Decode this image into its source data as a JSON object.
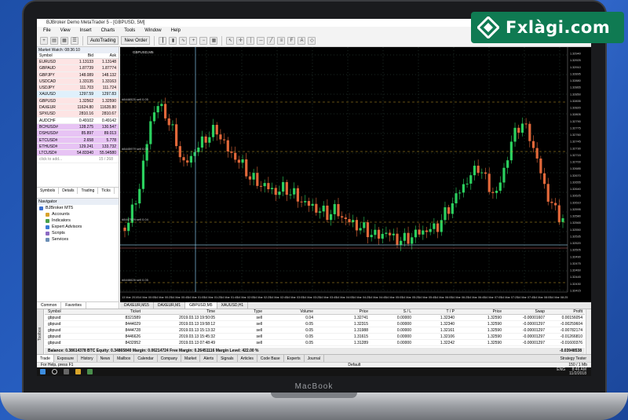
{
  "brand": {
    "logo_text": "Fxlàgi.com",
    "device_label": "MacBook"
  },
  "window": {
    "title": "BJBroker Demo MetaTrader 5 - [GBPUSD, 5M]"
  },
  "menu": [
    "File",
    "View",
    "Insert",
    "Charts",
    "Tools",
    "Window",
    "Help"
  ],
  "toolbar": {
    "autotrading": "AutoTrading",
    "new_order": "New Order"
  },
  "market_watch": {
    "header": "Market Watch: 08:36:10",
    "columns": [
      "Symbol",
      "Bid",
      "Ask"
    ],
    "rows": [
      {
        "symbol": "EURUSD",
        "bid": "1.13133",
        "ask": "1.13148",
        "color": "#fde4e4"
      },
      {
        "symbol": "GBPAUD",
        "bid": "1.87739",
        "ask": "1.87774",
        "color": "#fde4e4"
      },
      {
        "symbol": "GBPJPY",
        "bid": "148.089",
        "ask": "148.132",
        "color": "#fde4e4"
      },
      {
        "symbol": "USDCAD",
        "bid": "1.33135",
        "ask": "1.33163",
        "color": "#fde4e4"
      },
      {
        "symbol": "USDJPY",
        "bid": "111.703",
        "ask": "111.724",
        "color": "#fde4e4"
      },
      {
        "symbol": "XAUUSD",
        "bid": "1297.59",
        "ask": "1297.83",
        "color": "#dff0fb"
      },
      {
        "symbol": "GBPUSD",
        "bid": "1.32562",
        "ask": "1.32590",
        "color": "#fde4e4"
      },
      {
        "symbol": "DAXEUR",
        "bid": "11624.80",
        "ask": "11628.80",
        "color": "#fde4e4"
      },
      {
        "symbol": "SPXUSD",
        "bid": "2810.16",
        "ask": "2810.67",
        "color": "#fde4e4"
      },
      {
        "symbol": "AUDCHF",
        "bid": "0.49102",
        "ask": "0.49142",
        "color": "#ffffff"
      },
      {
        "symbol": "BCHUSD#",
        "bid": "128.275",
        "ask": "130.547",
        "color": "#e7c3f4"
      },
      {
        "symbol": "DSHUSD#",
        "bid": "85.897",
        "ask": "89.013",
        "color": "#e7c3f4"
      },
      {
        "symbol": "ETCUSD#",
        "bid": "2.658",
        "ask": "5.778",
        "color": "#e7c3f4"
      },
      {
        "symbol": "ETHUSD#",
        "bid": "129.241",
        "ask": "133.732",
        "color": "#e7c3f4"
      },
      {
        "symbol": "LTCUSD#",
        "bid": "54.83340",
        "ask": "55.94580",
        "color": "#e7c3f4"
      }
    ],
    "add_hint": "click to add...",
    "count": "15 / 268",
    "tabs": [
      "Symbols",
      "Details",
      "Trading",
      "Ticks"
    ]
  },
  "navigator": {
    "header": "Navigator",
    "items": [
      {
        "label": "BJBroker MT5",
        "icon": "broker-icon",
        "color": "#3b6fcf",
        "indent": 0
      },
      {
        "label": "Accounts",
        "icon": "accounts-icon",
        "color": "#d8a32c",
        "indent": 1
      },
      {
        "label": "Indicators",
        "icon": "indicators-icon",
        "color": "#49a14a",
        "indent": 1
      },
      {
        "label": "Expert Advisors",
        "icon": "experts-icon",
        "color": "#3a7bd5",
        "indent": 1
      },
      {
        "label": "Scripts",
        "icon": "scripts-icon",
        "color": "#8c6bc4",
        "indent": 1
      },
      {
        "label": "Services",
        "icon": "services-icon",
        "color": "#6c8fb6",
        "indent": 1
      }
    ],
    "tabs": [
      "Common",
      "Favorites"
    ]
  },
  "chart": {
    "label": "GBPUSD,M5",
    "price_scale": [
      "1.32940",
      "1.32925",
      "1.32910",
      "1.32895",
      "1.32880",
      "1.32865",
      "1.32850",
      "1.32835",
      "1.32820",
      "1.32805",
      "1.32790",
      "1.32775",
      "1.32760",
      "1.32745",
      "1.32730",
      "1.32715",
      "1.32700",
      "1.32685",
      "1.32670",
      "1.32655",
      "1.32640",
      "1.32625",
      "1.32610",
      "1.32595",
      "1.32580",
      "1.32565",
      "1.32550",
      "1.32535",
      "1.32520",
      "1.32505",
      "1.32490",
      "1.32475",
      "1.32460",
      "1.32445",
      "1.32430",
      "1.32415"
    ],
    "time_labels": [
      "13 Mar 2019",
      "14 Mar 00:05",
      "14 Mar 00:25",
      "14 Mar 00:45",
      "14 Mar 01:05",
      "14 Mar 01:25",
      "14 Mar 01:45",
      "14 Mar 02:05",
      "14 Mar 02:25",
      "14 Mar 02:45",
      "14 Mar 03:05",
      "14 Mar 03:25",
      "14 Mar 03:45",
      "14 Mar 04:05",
      "14 Mar 04:25",
      "14 Mar 04:45",
      "14 Mar 05:05",
      "14 Mar 05:25",
      "14 Mar 05:45",
      "14 Mar 06:05",
      "14 Mar 06:25",
      "14 Mar 06:45",
      "14 Mar 07:05",
      "14 Mar 07:25",
      "14 Mar 07:45",
      "14 Mar 08:05",
      "14 Mar 08:25"
    ],
    "order_labels": [
      "#8446525 sell 0.05",
      "#8445979 sell 0.05",
      "#8447529 sell 0.04",
      "#8446626 sell 0.05"
    ],
    "bull_color": "#2bd15f",
    "bear_color": "#e2683a",
    "tabs": [
      "DAXEUR,M15",
      "DAXEUR,M1",
      "GBPUSD,M5",
      "XAUUSD,H1"
    ]
  },
  "terminal": {
    "side_label": "Toolbox",
    "columns": [
      "Symbol",
      "Ticket",
      "Time",
      "Type",
      "Volume",
      "Price",
      "S / L",
      "T / P",
      "Price",
      "Swap",
      "Profit"
    ],
    "rows": [
      [
        "gbpusd",
        "8321589",
        "2019.03.13 19:50:05",
        "sell",
        "0.04",
        "1.32741",
        "0.00000",
        "1.32340",
        "1.32590",
        "-0.00001607",
        "0.00156054"
      ],
      [
        "gbpusd",
        "8444029",
        "2019.03.13 19:58:12",
        "sell",
        "0.05",
        "1.32315",
        "0.00000",
        "1.32340",
        "1.32590",
        "-0.00001297",
        "-0.00259604"
      ],
      [
        "gbpusd",
        "8444728",
        "2019.03.13 15:13:32",
        "sell",
        "0.05",
        "1.31988",
        "0.00000",
        "1.32161",
        "1.32590",
        "-0.00001297",
        "-0.00782174"
      ],
      [
        "gbpusd",
        "8446626",
        "2019.03.13 15:45:32",
        "sell",
        "0.05",
        "1.31615",
        "0.00000",
        "1.32106",
        "1.32590",
        "-0.00001297",
        "-0.01266810"
      ],
      [
        "gbpusd",
        "8432952",
        "2019.03.13 07:48:49",
        "sell",
        "0.05",
        "1.31289",
        "0.00000",
        "1.32242",
        "1.32590",
        "-0.00001297",
        "-0.01600376"
      ]
    ],
    "balance": "Balance: 0.38614378 BTC  Equity: 0.34865840  Margin: 0.06214724  Free Margin: 0.26451116  Margin Level: 422.00 %",
    "total_profit": "-0.03948538",
    "tabs": [
      "Trade",
      "Exposure",
      "History",
      "News",
      "Mailbox",
      "Calendar",
      "Company",
      "Market",
      "Alerts",
      "Signals",
      "Articles",
      "Code Base",
      "Experts",
      "Journal"
    ],
    "strategy_tester": "Strategy Tester"
  },
  "status": {
    "help": "For Help, press F1",
    "profile": "Default",
    "traffic": "150 / 1 Mb"
  },
  "taskbar": {
    "lang": "ENG",
    "time": "8:46 AM",
    "date": "11/2/2018"
  }
}
